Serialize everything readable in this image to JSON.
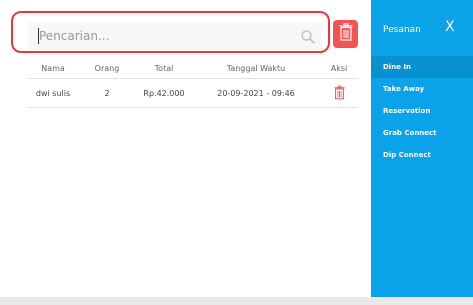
{
  "search": {
    "placeholder": "Pencarian..."
  },
  "table": {
    "headers": [
      "Nama",
      "Orang",
      "Total",
      "Tanggal Waktu",
      "Aksi"
    ],
    "rows": [
      {
        "nama": "dwi sulis",
        "orang": "2",
        "total": "Rp.42.000",
        "tanggal": "20-09-2021 - 09:46"
      }
    ]
  },
  "sidebar": {
    "title": "Pesanan",
    "close": "X",
    "items": [
      {
        "label": "Dine In"
      },
      {
        "label": "Take Away"
      },
      {
        "label": "Reservation"
      },
      {
        "label": "Grab Connect"
      },
      {
        "label": "Dip Connect"
      }
    ]
  },
  "colors": {
    "accent": "#0aa2e9",
    "danger": "#f05454",
    "highlight": "#e53a3a"
  }
}
